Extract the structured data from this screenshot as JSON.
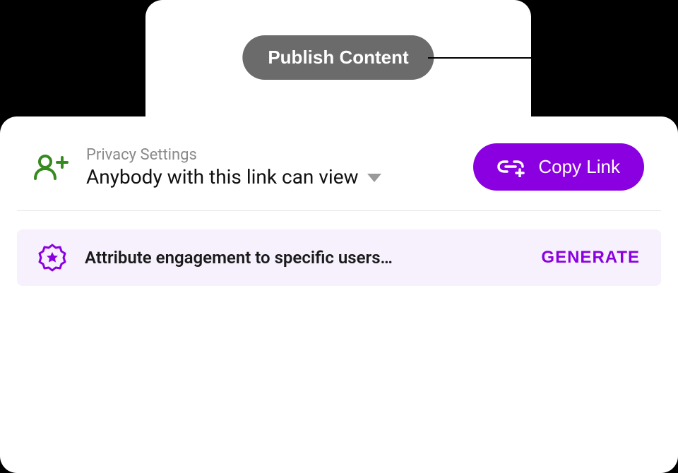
{
  "top": {
    "publish_label": "Publish Content"
  },
  "privacy": {
    "label": "Privacy Settings",
    "value": "Anybody with this link can view"
  },
  "copy_link": {
    "label": "Copy Link"
  },
  "attribution": {
    "text": "Attribute engagement to specific users…",
    "action": "GENERATE"
  },
  "colors": {
    "accent": "#8b00e0",
    "icon_green": "#368a1f"
  }
}
